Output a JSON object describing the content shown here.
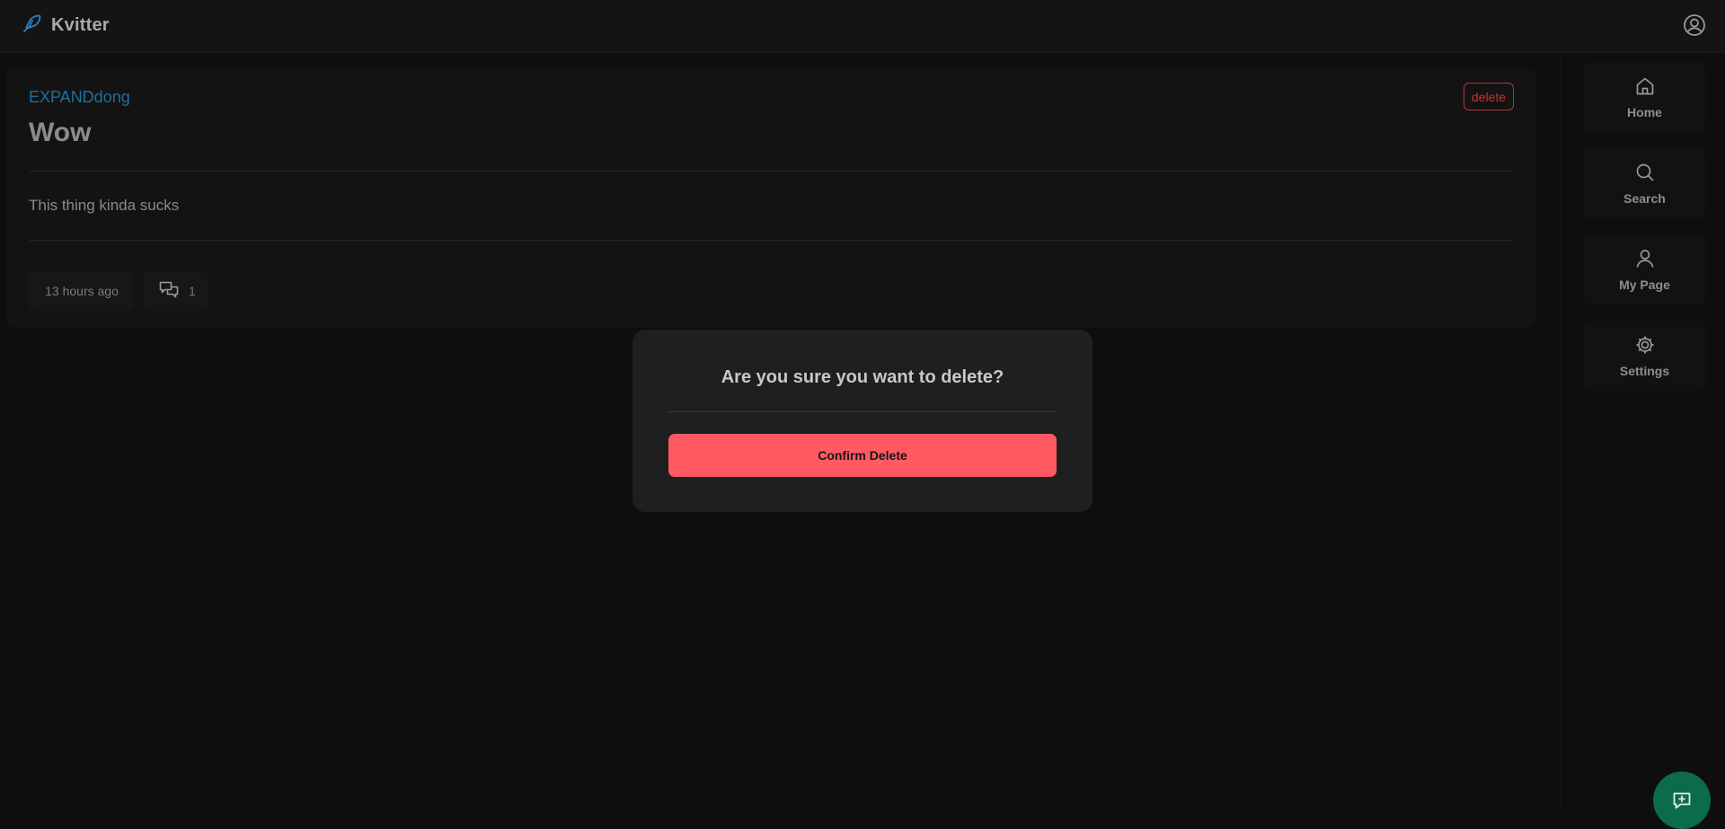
{
  "app": {
    "name": "Kvitter"
  },
  "header": {
    "user_icon": "user-circle-icon"
  },
  "post": {
    "author": "EXPANDdong",
    "delete_label": "delete",
    "title": "Wow",
    "body": "This thing kinda sucks",
    "timestamp": "13 hours ago",
    "comment_count": "1"
  },
  "sidebar": {
    "items": [
      {
        "label": "Home",
        "icon": "home-icon"
      },
      {
        "label": "Search",
        "icon": "search-icon"
      },
      {
        "label": "My Page",
        "icon": "user-icon"
      },
      {
        "label": "Settings",
        "icon": "gear-icon"
      }
    ]
  },
  "modal": {
    "title": "Are you sure you want to delete?",
    "confirm_label": "Confirm Delete"
  },
  "fab": {
    "icon": "new-message-icon"
  },
  "colors": {
    "accent_blue": "#1f6f9e",
    "danger": "#ff5a62",
    "fab_green": "#0b6b4c"
  }
}
